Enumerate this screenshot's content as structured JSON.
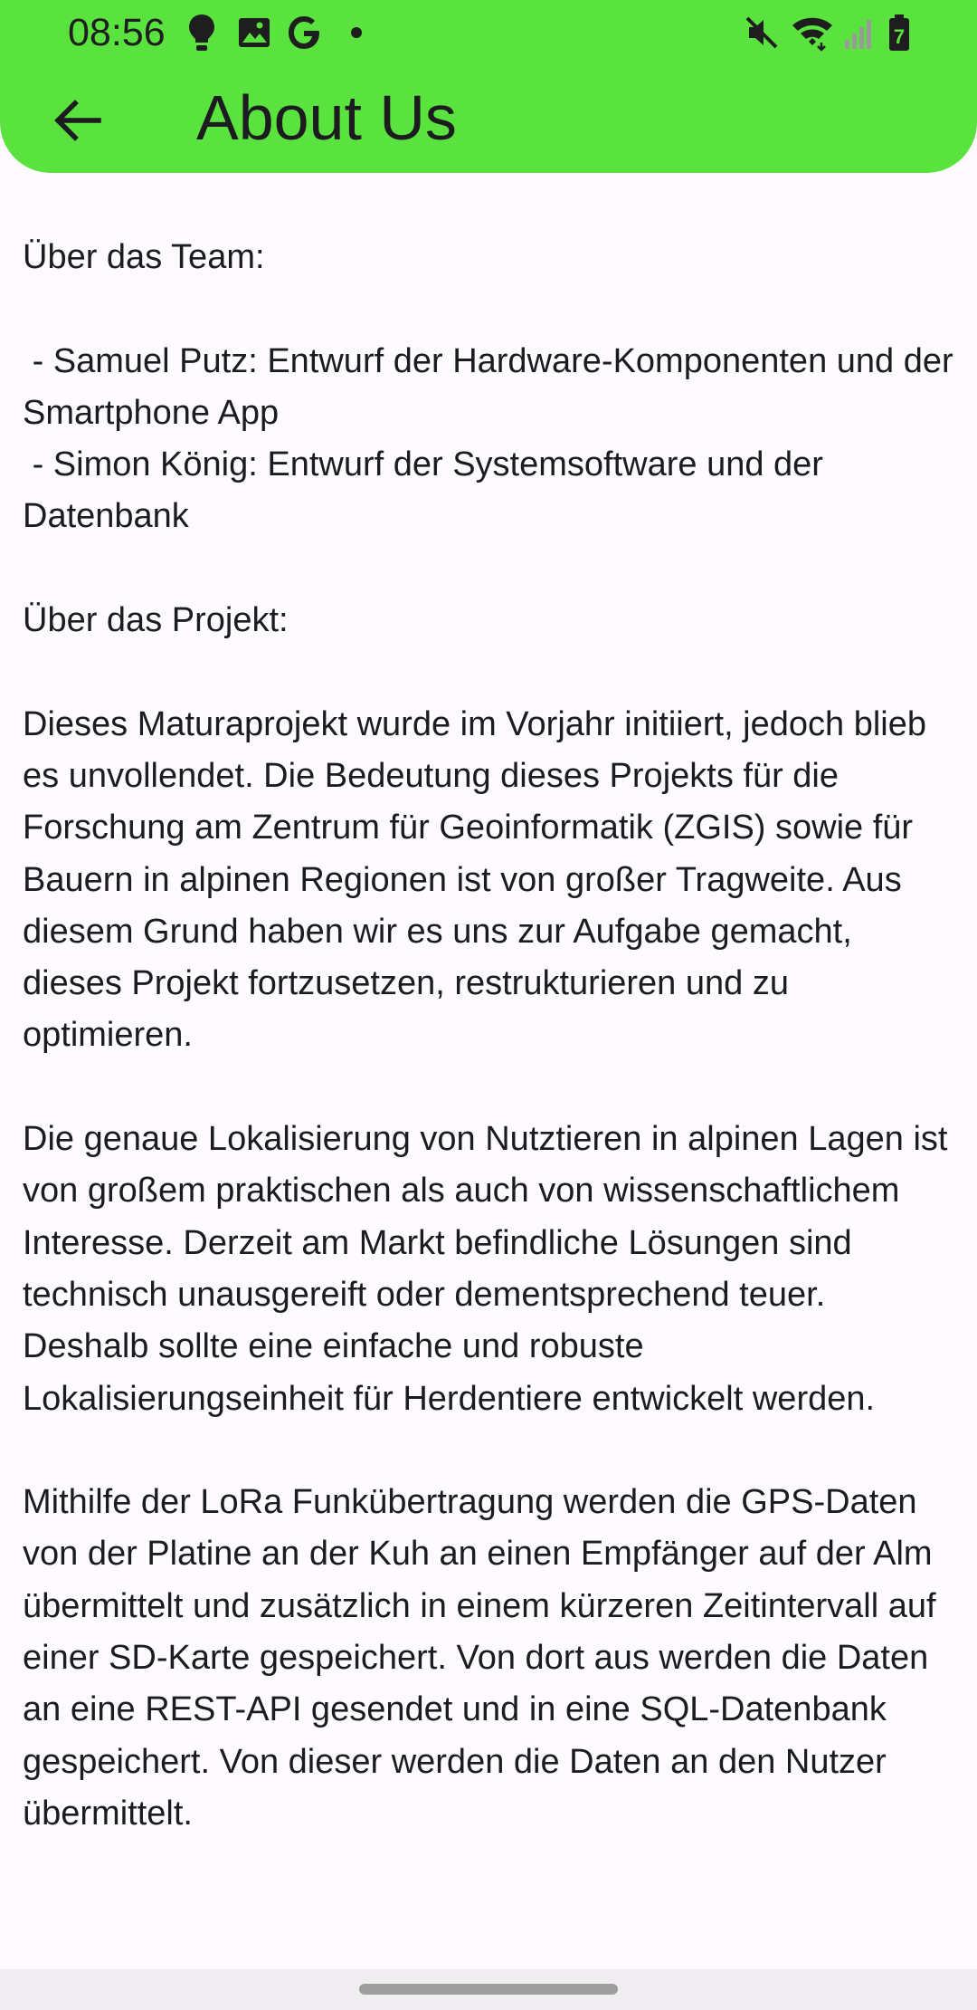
{
  "status_bar": {
    "time": "08:56",
    "notification_icons": [
      "lightbulb-icon",
      "image-icon",
      "google-icon",
      "dot-icon"
    ],
    "system_icons": [
      "mute-icon",
      "wifi-icon",
      "signal-icon",
      "battery-icon"
    ],
    "battery_level": "7"
  },
  "app_bar": {
    "title": "About Us",
    "back_icon": "arrow-back-icon",
    "color": "#5ae23e"
  },
  "content": {
    "team_heading": "Über das Team:",
    "team_member_1": " - Samuel Putz: Entwurf der Hardware-Komponenten und der Smartphone App",
    "team_member_2": " - Simon König: Entwurf der Systemsoftware und der Datenbank",
    "project_heading": "Über das Projekt:",
    "paragraph_1": "Dieses Maturaprojekt wurde im Vorjahr initiiert, jedoch blieb es unvollendet. Die Bedeutung dieses Projekts für die Forschung am Zentrum für Geoinformatik (ZGIS) sowie für Bauern in alpinen Regionen ist von großer Tragweite. Aus diesem Grund haben wir es uns zur Aufgabe gemacht, dieses Projekt fortzusetzen, restrukturieren und zu optimieren.",
    "paragraph_2": "Die genaue Lokalisierung von Nutztieren in alpinen Lagen ist von großem praktischen als auch von wissenschaftlichem Interesse. Derzeit am Markt befindliche Lösungen sind technisch unausgereift oder dementsprechend teuer. Deshalb sollte eine einfache und robuste Lokalisierungseinheit für Herdentiere entwickelt werden.",
    "paragraph_3": "Mithilfe der LoRa Funkübertragung werden die GPS-Daten von der Platine an der Kuh an einen Empfänger auf der Alm übermittelt und zusätzlich in einem kürzeren Zeitintervall auf einer SD-Karte gespeichert. Von dort aus werden die Daten an eine REST-API gesendet und in eine SQL-Datenbank gespeichert. Von dieser werden die Daten an den Nutzer übermittelt."
  }
}
